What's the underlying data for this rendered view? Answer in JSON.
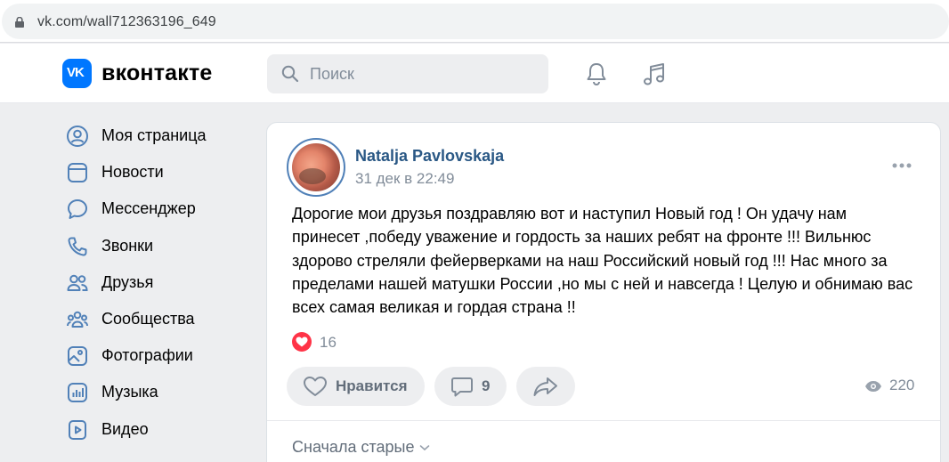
{
  "browser": {
    "url": "vk.com/wall712363196_649"
  },
  "header": {
    "logo_mark": "VK",
    "logo_text": "вконтакте",
    "search_placeholder": "Поиск",
    "icons": [
      "bell-icon",
      "music-icon"
    ]
  },
  "sidebar": {
    "items": [
      {
        "label": "Моя страница",
        "icon": "profile-icon"
      },
      {
        "label": "Новости",
        "icon": "news-icon"
      },
      {
        "label": "Мессенджер",
        "icon": "messenger-icon"
      },
      {
        "label": "Звонки",
        "icon": "phone-icon"
      },
      {
        "label": "Друзья",
        "icon": "friends-icon"
      },
      {
        "label": "Сообщества",
        "icon": "communities-icon"
      },
      {
        "label": "Фотографии",
        "icon": "photos-icon"
      },
      {
        "label": "Музыка",
        "icon": "music-icon"
      },
      {
        "label": "Видео",
        "icon": "video-icon"
      }
    ]
  },
  "post": {
    "author": "Natalja Pavlovskaja",
    "date": "31 дек в 22:49",
    "text_lines": [
      "Дорогие мои друзья поздравляю вот и наступил Новый год ! Он удачу нам",
      "принесет ,победу уважение и гордость за наших ребят на фронте !!! Вильнюс",
      "здорово стреляли фейерверками на наш Российский новый год !!! Нас много за",
      "пределами нашей матушки России ,но мы с ней и навсегда ! Целую и обнимаю вас",
      "всех самая великая и гордая страна !!"
    ],
    "reactions_count": "16",
    "like_label": "Нравится",
    "comments_count": "9",
    "views_count": "220",
    "sort_label": "Сначала старые"
  },
  "colors": {
    "brand": "#0077ff",
    "link": "#2a5885",
    "muted": "#818c99",
    "heart": "#ff3347",
    "page_bg": "#edeef0"
  }
}
